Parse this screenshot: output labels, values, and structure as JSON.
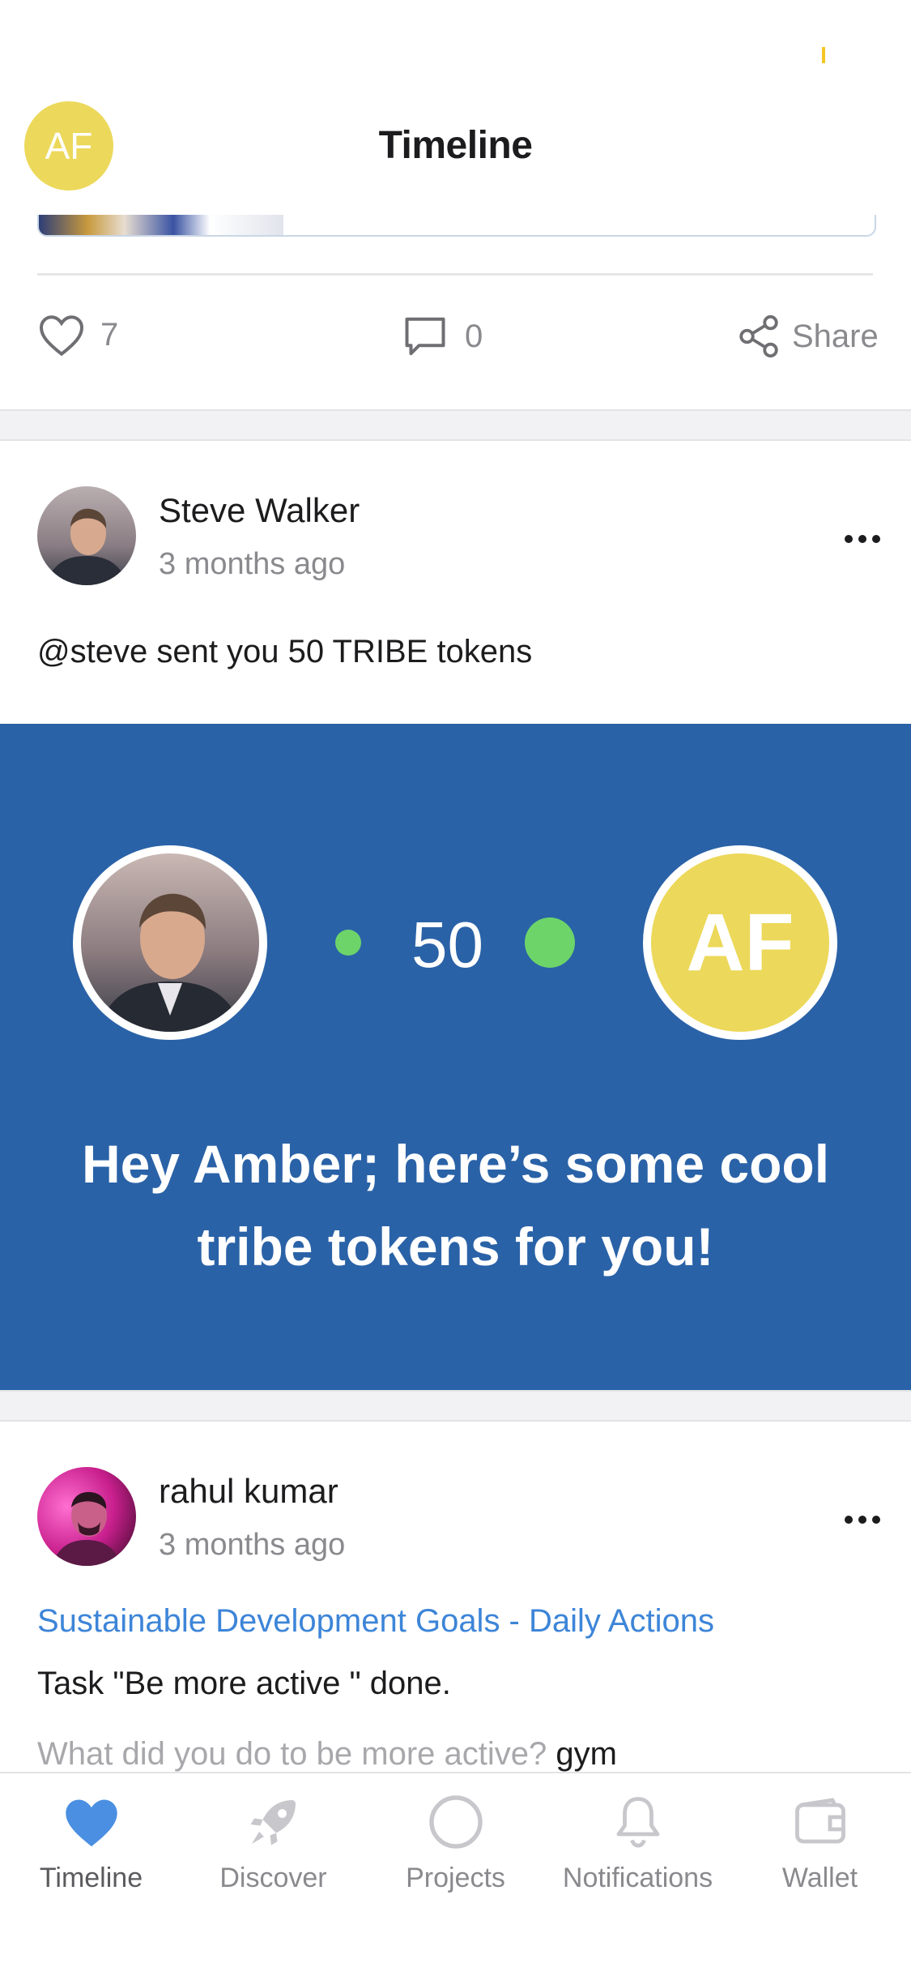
{
  "header": {
    "title": "Timeline",
    "avatar_initials": "AF"
  },
  "previous_post": {
    "likes": "7",
    "comments": "0",
    "share_label": "Share"
  },
  "posts": [
    {
      "author": "Steve Walker",
      "time": "3 months ago",
      "text": "@steve sent you 50 TRIBE tokens",
      "transfer": {
        "amount": "50",
        "recipient_initials": "AF",
        "message": "Hey Amber; here’s some cool tribe tokens for you!"
      }
    },
    {
      "author": "rahul kumar",
      "time": "3 months ago",
      "project_link": "Sustainable Development Goals - Daily Actions",
      "text": "Task \"Be more active \" done.",
      "question": "What did you do to be more active?",
      "answer": "gym"
    }
  ],
  "tabbar": {
    "items": [
      {
        "label": "Timeline",
        "icon": "heart-icon",
        "active": true
      },
      {
        "label": "Discover",
        "icon": "rocket-icon",
        "active": false
      },
      {
        "label": "Projects",
        "icon": "circle-icon",
        "active": false
      },
      {
        "label": "Notifications",
        "icon": "bell-icon",
        "active": false
      },
      {
        "label": "Wallet",
        "icon": "wallet-icon",
        "active": false
      }
    ]
  },
  "colors": {
    "banner": "#2a62a7",
    "accent": "#3d85d8",
    "avatar_yellow": "#ecd85a",
    "token_green": "#6dd46a"
  }
}
